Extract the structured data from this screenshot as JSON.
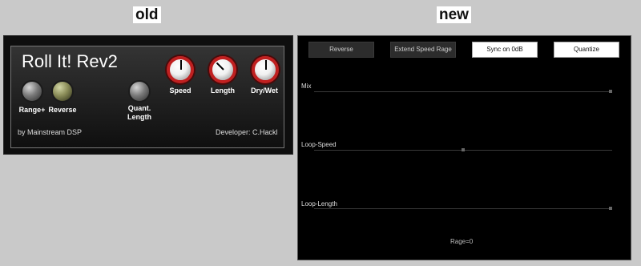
{
  "headings": {
    "old": "old",
    "new": "new"
  },
  "old_plugin": {
    "title": "Roll It! Rev2",
    "knobs": [
      {
        "label": "Range+",
        "style": "gray"
      },
      {
        "label": "Reverse",
        "style": "olive"
      },
      {
        "label": "Quant.\nLength",
        "style": "gray"
      },
      {
        "label": "Speed",
        "style": "red"
      },
      {
        "label": "Length",
        "style": "red"
      },
      {
        "label": "Dry/Wet",
        "style": "red"
      }
    ],
    "footer_left": "by Mainstream DSP",
    "footer_right": "Developer: C.Hackl"
  },
  "new_plugin": {
    "buttons": [
      {
        "label": "Reverse",
        "style": "dark"
      },
      {
        "label": "Extend Speed Rage",
        "style": "dark"
      },
      {
        "label": "Sync on 0dB",
        "style": "light"
      },
      {
        "label": "Quantize",
        "style": "light"
      }
    ],
    "sliders": [
      {
        "label": "Mix",
        "value": 1.0
      },
      {
        "label": "Loop-Speed",
        "value": 0.5
      },
      {
        "label": "Loop-Length",
        "value": 1.0
      }
    ],
    "status": "Rage=0"
  },
  "colors": {
    "knob_ring_red": "#c02020",
    "panel_bg": "#000000",
    "page_bg": "#c9c9c9"
  }
}
